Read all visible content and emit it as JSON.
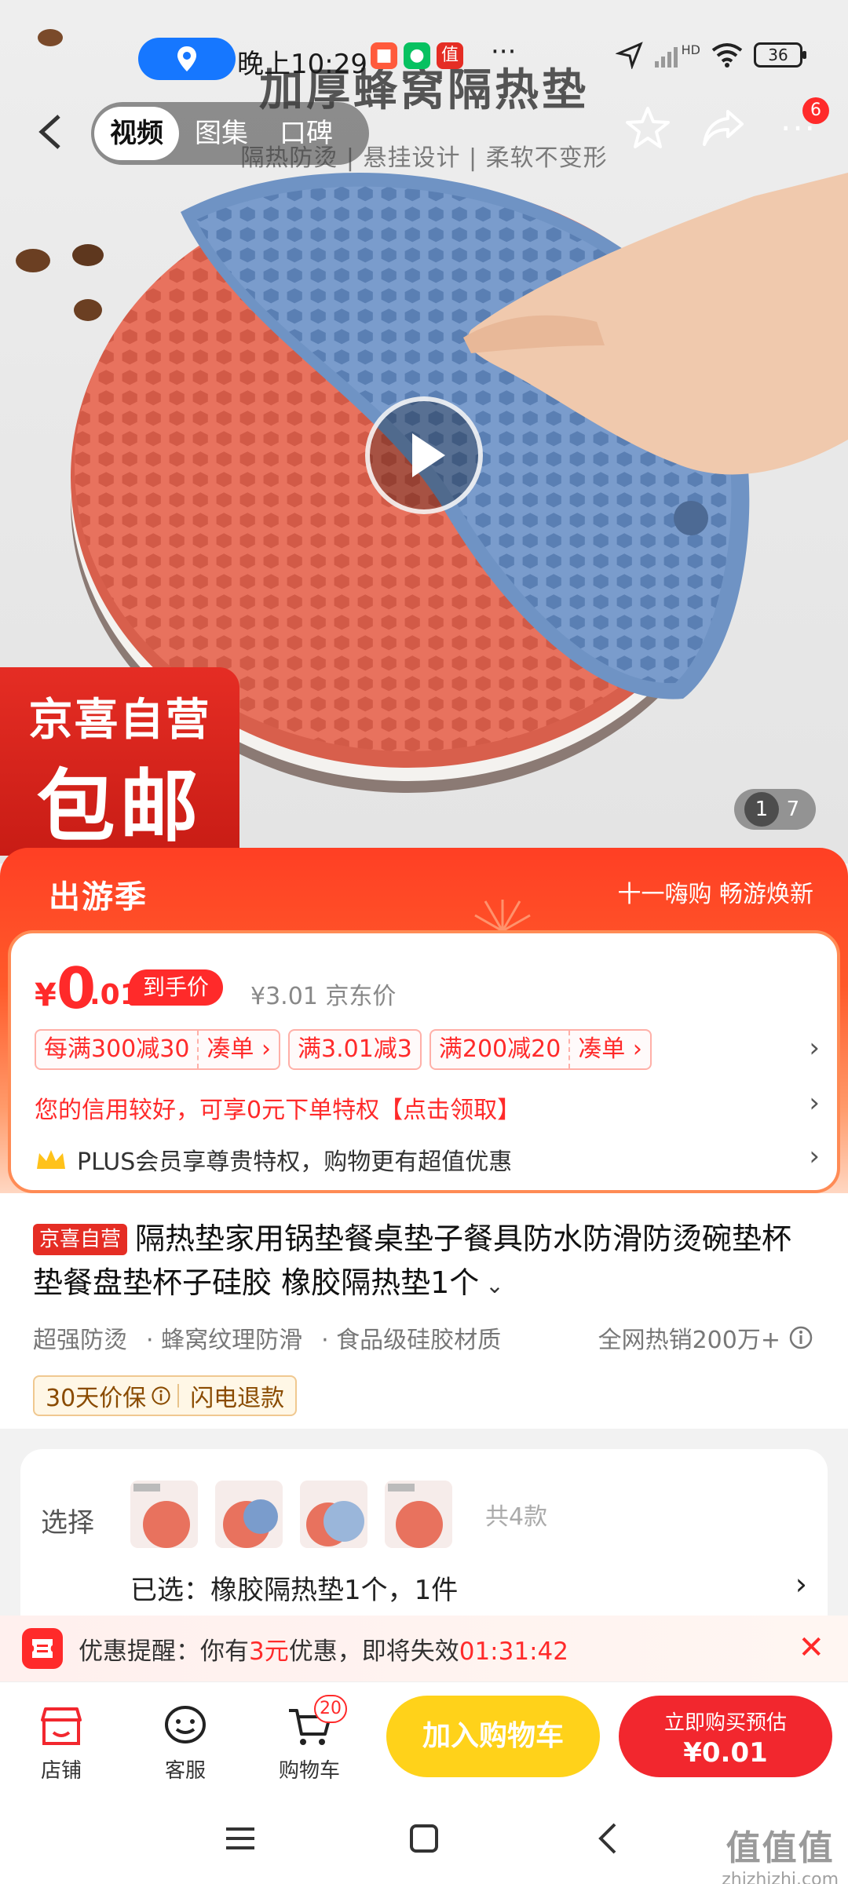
{
  "status_bar": {
    "time": "晚上10:29",
    "network": "HD",
    "battery": "36",
    "app_icon_value": "值"
  },
  "nav": {
    "tabs": [
      {
        "label": "视频"
      },
      {
        "label": "图集"
      },
      {
        "label": "口碑"
      }
    ],
    "more_badge": "6"
  },
  "hero": {
    "headline": "加厚蜂窝隔热垫",
    "subline": "隔热防烫 | 悬挂设计 | 柔软不变形"
  },
  "promo_stamp": {
    "line1": "京喜自营",
    "line2": "包邮"
  },
  "pager": {
    "current": "1",
    "total": "7"
  },
  "festival": {
    "title": "出游季",
    "slogan": "十一嗨购 畅游焕新"
  },
  "price": {
    "currency": "¥",
    "integer": "0",
    "decimal": ".01",
    "tag": "到手价",
    "original": "¥3.01 京东价",
    "coupons": [
      {
        "amount": "每满300减30",
        "action": "凑单 ›"
      },
      {
        "amount": "满3.01减3",
        "action": ""
      },
      {
        "amount": "满200减20",
        "action": "凑单 ›"
      }
    ],
    "credit_offer": "您的信用较好，可享0元下单特权【点击领取】",
    "plus_offer": "PLUS会员享尊贵特权，购物更有超值优惠"
  },
  "product": {
    "badge": "京喜自营",
    "title": "隔热垫家用锅垫餐桌垫子餐具防水防滑防烫碗垫杯垫餐盘垫杯子硅胶 橡胶隔热垫1个",
    "features": [
      "超强防烫",
      "· 蜂窝纹理防滑",
      "· 食品级硅胶材质"
    ],
    "sales": "全网热销200万+",
    "guarantees": [
      "30天价保",
      "闪电退款"
    ]
  },
  "selection": {
    "label": "选择",
    "count": "共4款",
    "selected": "已选：橡胶隔热垫1个，1件"
  },
  "reminder": {
    "prefix": "优惠提醒：你有",
    "amount": "3元",
    "middle": "优惠，即将失效",
    "countdown": "01:31:42"
  },
  "bottom_bar": {
    "shop": "店铺",
    "service": "客服",
    "cart": "购物车",
    "cart_count": "20",
    "add_to_cart": "加入购物车",
    "buy_line1": "立即购买预估",
    "buy_line2": "¥0.01"
  },
  "watermark": {
    "mark": "值值值",
    "url": "zhizhizhi.com"
  },
  "colors": {
    "accent_red": "#f2272e",
    "cart_yellow": "#ffd21a",
    "price_red": "#ff2a2a",
    "blue_mat": "#6f93c4",
    "red_mat": "#e8725e"
  }
}
